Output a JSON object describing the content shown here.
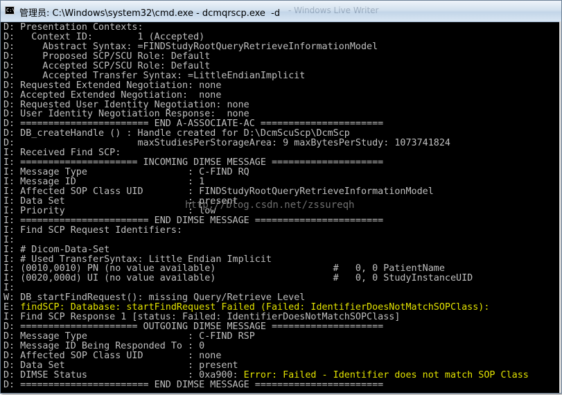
{
  "window": {
    "title": "管理员: C:\\Windows\\system32\\cmd.exe - dcmqrscp.exe  -d",
    "ghost_title": "- Windows Live Writer"
  },
  "watermark": "http://blog.csdn.net/zssureqh",
  "lines": [
    {
      "text": "D: Presentation Contexts:"
    },
    {
      "text": "D:   Context ID:        1 (Accepted)"
    },
    {
      "text": "D:     Abstract Syntax: =FINDStudyRootQueryRetrieveInformationModel"
    },
    {
      "text": "D:     Proposed SCP/SCU Role: Default"
    },
    {
      "text": "D:     Accepted SCP/SCU Role: Default"
    },
    {
      "text": "D:     Accepted Transfer Syntax: =LittleEndianImplicit"
    },
    {
      "text": "D: Requested Extended Negotiation: none"
    },
    {
      "text": "D: Accepted Extended Negotiation:  none"
    },
    {
      "text": "D: Requested User Identity Negotiation: none"
    },
    {
      "text": "D: User Identity Negotiation Response:  none"
    },
    {
      "text": "D: ======================= END A-ASSOCIATE-AC ======================"
    },
    {
      "text": "D: DB_createHandle () : Handle created for D:\\DcmScuScp\\DcmScp"
    },
    {
      "text": "D:                      maxStudiesPerStorageArea: 9 maxBytesPerStudy: 1073741824"
    },
    {
      "text": "I: Received Find SCP:"
    },
    {
      "text": "I: ===================== INCOMING DIMSE MESSAGE ===================="
    },
    {
      "text": "I: Message Type                  : C-FIND RQ"
    },
    {
      "text": "I: Message ID                    : 1"
    },
    {
      "text": "I: Affected SOP Class UID        : FINDStudyRootQueryRetrieveInformationModel"
    },
    {
      "text": "I: Data Set                      : present"
    },
    {
      "text": "I: Priority                      : low"
    },
    {
      "text": "I: ======================= END DIMSE MESSAGE ======================="
    },
    {
      "text": "I: Find SCP Request Identifiers:"
    },
    {
      "text": "I:"
    },
    {
      "text": "I: # Dicom-Data-Set"
    },
    {
      "text": "I: # Used TransferSyntax: Little Endian Implicit"
    },
    {
      "text": "I: (0010,0010) PN (no value available)                     #   0, 0 PatientName"
    },
    {
      "text": "I: (0020,000d) UI (no value available)                     #   0, 0 StudyInstanceUID"
    },
    {
      "text": "I:"
    },
    {
      "text": "W: DB_startFindRequest(): missing Query/Retrieve Level"
    },
    {
      "text": "E: ",
      "highlight": "findSCP: Database: startFindRequest Failed (Failed: IdentifierDoesNotMatchSOPClass):"
    },
    {
      "text": "I: Find SCP Response 1 [status: Failed: IdentifierDoesNotMatchSOPClass]"
    },
    {
      "text": "D: ===================== OUTGOING DIMSE MESSAGE ===================="
    },
    {
      "text": "D: Message Type                  : C-FIND RSP"
    },
    {
      "text": "D: Message ID Being Responded To : 0"
    },
    {
      "text": "D: Affected SOP Class UID        : none"
    },
    {
      "text": "D: Data Set                      : present"
    },
    {
      "text": "D: DIMSE Status                  : 0xa900: ",
      "highlight": "Error: Failed - Identifier does not match SOP Class"
    },
    {
      "text": "D: ======================= END DIMSE MESSAGE ======================="
    }
  ]
}
